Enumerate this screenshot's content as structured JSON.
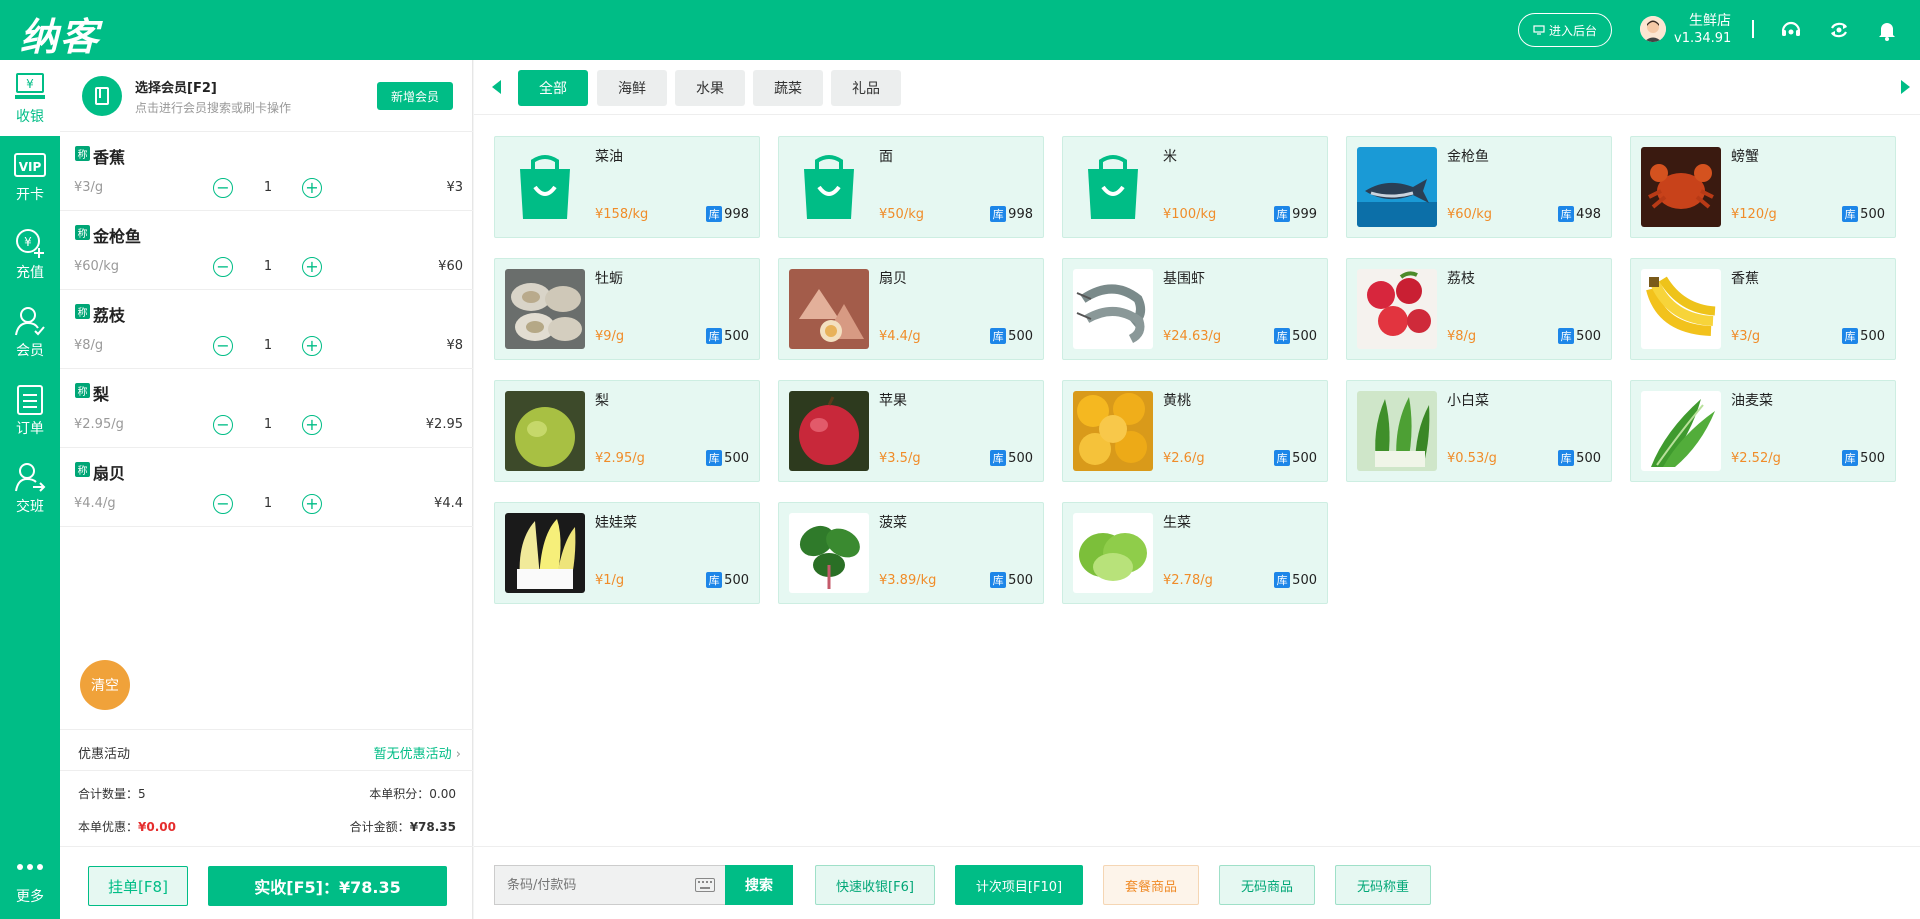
{
  "header": {
    "logo": "纳客",
    "backend_label": "进入后台",
    "store_name": "生鲜店",
    "version": "v1.34.91"
  },
  "nav": [
    {
      "label": "收银",
      "icon": "cashier-icon"
    },
    {
      "label": "开卡",
      "icon": "vip-card-icon"
    },
    {
      "label": "充值",
      "icon": "recharge-icon"
    },
    {
      "label": "会员",
      "icon": "member-icon"
    },
    {
      "label": "订单",
      "icon": "order-icon"
    },
    {
      "label": "交班",
      "icon": "shift-icon"
    },
    {
      "label": "更多",
      "icon": "more-icon"
    }
  ],
  "member": {
    "title": "选择会员[F2]",
    "subtitle": "点击进行会员搜索或刷卡操作",
    "new_button": "新增会员"
  },
  "cart_items": [
    {
      "tag": "称",
      "name": "香蕉",
      "unit": "¥3/g",
      "qty": "1",
      "total": "¥3"
    },
    {
      "tag": "称",
      "name": "金枪鱼",
      "unit": "¥60/kg",
      "qty": "1",
      "total": "¥60"
    },
    {
      "tag": "称",
      "name": "荔枝",
      "unit": "¥8/g",
      "qty": "1",
      "total": "¥8"
    },
    {
      "tag": "称",
      "name": "梨",
      "unit": "¥2.95/g",
      "qty": "1",
      "total": "¥2.95"
    },
    {
      "tag": "称",
      "name": "扇贝",
      "unit": "¥4.4/g",
      "qty": "1",
      "total": "¥4.4"
    }
  ],
  "cart": {
    "clear": "清空",
    "promo_label": "优惠活动",
    "promo_value": "暂无优惠活动",
    "total_qty_label": "合计数量：",
    "total_qty": "5",
    "points_label": "本单积分：",
    "points": "0.00",
    "discount_label": "本单优惠：",
    "discount": "¥0.00",
    "amount_label": "合计金额：",
    "amount": "¥78.35",
    "hold_button": "挂单[F8]",
    "pay_button": "实收[F5]：¥78.35"
  },
  "tabs": [
    "全部",
    "海鲜",
    "水果",
    "蔬菜",
    "礼品"
  ],
  "products": [
    {
      "name": "菜油",
      "price": "¥158/kg",
      "stock_label": "库",
      "stock": "998",
      "image": "bag"
    },
    {
      "name": "面",
      "price": "¥50/kg",
      "stock_label": "库",
      "stock": "998",
      "image": "bag"
    },
    {
      "name": "米",
      "price": "¥100/kg",
      "stock_label": "库",
      "stock": "999",
      "image": "bag"
    },
    {
      "name": "金枪鱼",
      "price": "¥60/kg",
      "stock_label": "库",
      "stock": "498",
      "image": "tuna"
    },
    {
      "name": "螃蟹",
      "price": "¥120/g",
      "stock_label": "库",
      "stock": "500",
      "image": "crab"
    },
    {
      "name": "牡蛎",
      "price": "¥9/g",
      "stock_label": "库",
      "stock": "500",
      "image": "oyster"
    },
    {
      "name": "扇贝",
      "price": "¥4.4/g",
      "stock_label": "库",
      "stock": "500",
      "image": "scallop"
    },
    {
      "name": "基围虾",
      "price": "¥24.63/g",
      "stock_label": "库",
      "stock": "500",
      "image": "shrimp"
    },
    {
      "name": "荔枝",
      "price": "¥8/g",
      "stock_label": "库",
      "stock": "500",
      "image": "lychee"
    },
    {
      "name": "香蕉",
      "price": "¥3/g",
      "stock_label": "库",
      "stock": "500",
      "image": "banana"
    },
    {
      "name": "梨",
      "price": "¥2.95/g",
      "stock_label": "库",
      "stock": "500",
      "image": "pear"
    },
    {
      "name": "苹果",
      "price": "¥3.5/g",
      "stock_label": "库",
      "stock": "500",
      "image": "apple"
    },
    {
      "name": "黄桃",
      "price": "¥2.6/g",
      "stock_label": "库",
      "stock": "500",
      "image": "peach"
    },
    {
      "name": "小白菜",
      "price": "¥0.53/g",
      "stock_label": "库",
      "stock": "500",
      "image": "bokchoy"
    },
    {
      "name": "油麦菜",
      "price": "¥2.52/g",
      "stock_label": "库",
      "stock": "500",
      "image": "lettuce-long"
    },
    {
      "name": "娃娃菜",
      "price": "¥1/g",
      "stock_label": "库",
      "stock": "500",
      "image": "babycabbage"
    },
    {
      "name": "菠菜",
      "price": "¥3.89/kg",
      "stock_label": "库",
      "stock": "500",
      "image": "spinach"
    },
    {
      "name": "生菜",
      "price": "¥2.78/g",
      "stock_label": "库",
      "stock": "500",
      "image": "lettuce"
    }
  ],
  "footer": {
    "search_placeholder": "条码/付款码",
    "search_button": "搜索",
    "quick_cash": "快速收银[F6]",
    "count_items": "计次项目[F10]",
    "combo": "套餐商品",
    "no_code": "无码商品",
    "no_code_weigh": "无码称重"
  },
  "colors": {
    "primary": "#00bd86",
    "price": "#f08c29",
    "stock_badge": "#1d86e8",
    "discount": "#e52d2d",
    "clear": "#f0a23a"
  }
}
